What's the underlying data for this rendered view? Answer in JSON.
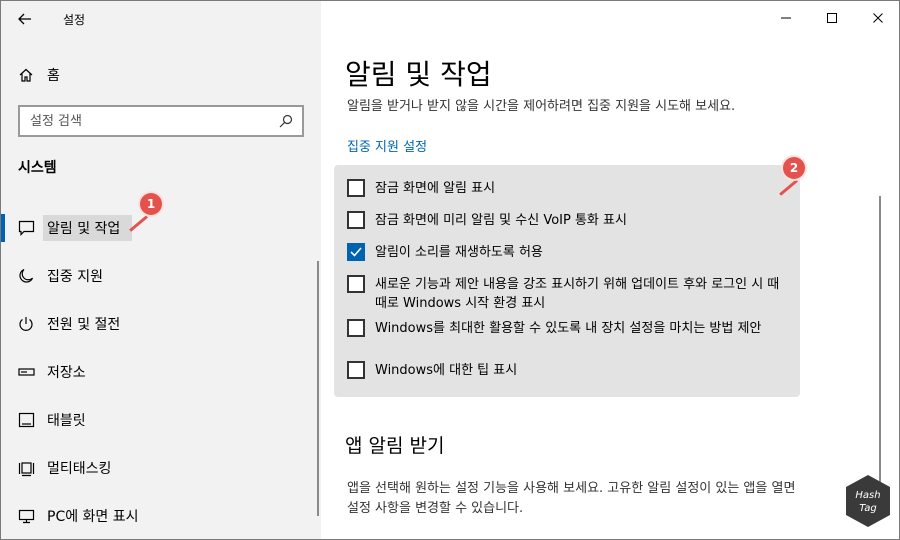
{
  "window": {
    "title": "설정",
    "controls": [
      "minimize-icon",
      "maximize-icon",
      "close-icon"
    ]
  },
  "sidebar": {
    "home_label": "홈",
    "search_placeholder": "설정 검색",
    "section_label": "시스템",
    "items": [
      {
        "label": "알림 및 작업",
        "icon": "chat-bubble-icon",
        "active": true
      },
      {
        "label": "집중 지원",
        "icon": "moon-icon"
      },
      {
        "label": "전원 및 절전",
        "icon": "power-icon"
      },
      {
        "label": "저장소",
        "icon": "storage-icon"
      },
      {
        "label": "태블릿",
        "icon": "tablet-icon"
      },
      {
        "label": "멀티태스킹",
        "icon": "multitasking-icon"
      },
      {
        "label": "PC에 화면 표시",
        "icon": "project-icon"
      }
    ]
  },
  "main": {
    "title": "알림 및 작업",
    "description": "알림을 받거나 받지 않을 시간을 제어하려면 집중 지원을 시도해 보세요.",
    "focus_link": "집중 지원 설정",
    "options": [
      {
        "label": "잠금 화면에 알림 표시",
        "checked": false
      },
      {
        "label": "잠금 화면에 미리 알림 및 수신 VoIP 통화 표시",
        "checked": false
      },
      {
        "label": "알림이 소리를 재생하도록 허용",
        "checked": true
      },
      {
        "label": "새로운 기능과 제안 내용을 강조 표시하기 위해 업데이트 후와 로그인 시 때때로 Windows 시작 환경 표시",
        "checked": false
      },
      {
        "label": "Windows를 최대한 활용할 수 있도록 내 장치 설정을 마치는 방법 제안",
        "checked": false
      },
      {
        "label": "Windows에 대한 팁 표시",
        "checked": false
      }
    ],
    "section2_title": "앱 알림 받기",
    "section2_description": "앱을 선택해 원하는 설정 기능을 사용해 보세요. 고유한 알림 설정이 있는 앱을 열면 설정 사항을 변경할 수 있습니다."
  },
  "annotations": {
    "badge1": "1",
    "badge2": "2"
  },
  "watermark": {
    "line1": "Hash",
    "line2": "Tag"
  },
  "colors": {
    "accent": "#0063b1",
    "link": "#0066b4",
    "badge": "#e4524d",
    "sidebar_bg": "#f2f2f2",
    "panel_bg": "#e3e3e3"
  }
}
